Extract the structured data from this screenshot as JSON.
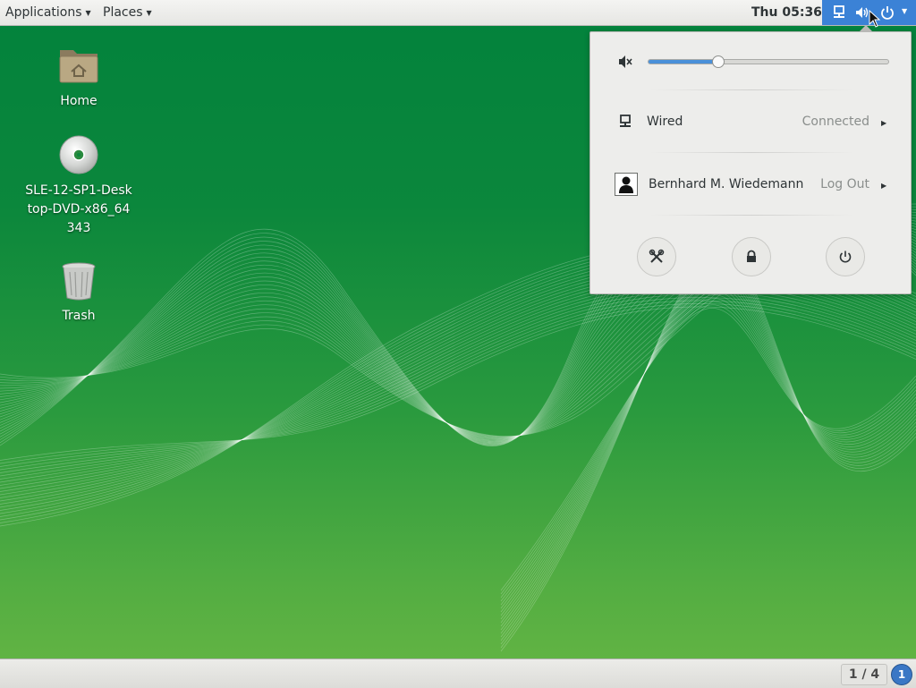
{
  "topbar": {
    "applications_label": "Applications",
    "places_label": "Places",
    "clock": "Thu 05:36"
  },
  "status_icons": [
    "network-wired-icon",
    "volume-icon",
    "power-icon"
  ],
  "popup": {
    "volume_icon": "volume-muted-icon",
    "volume_level_percent": 29,
    "network": {
      "label": "Wired",
      "state": "Connected"
    },
    "user": {
      "name": "Bernhard M. Wiedemann",
      "action": "Log Out"
    },
    "buttons": [
      "settings-icon",
      "lock-icon",
      "power-icon"
    ]
  },
  "desktop_icons": [
    {
      "name": "home",
      "label": "Home"
    },
    {
      "name": "dvd",
      "label": "SLE-12-SP1-Desktop-DVD-x86_64343"
    },
    {
      "name": "trash",
      "label": "Trash"
    }
  ],
  "bottombar": {
    "workspace": "1 / 4",
    "message_count": "1"
  },
  "colors": {
    "accent": "#3b82d6",
    "desktop_green": "#0b873c"
  }
}
